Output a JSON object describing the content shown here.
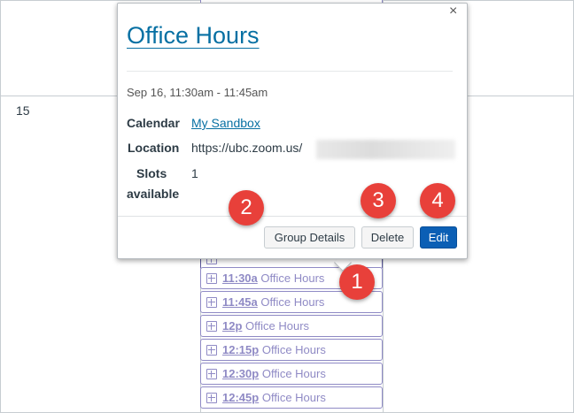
{
  "calendar": {
    "day_number": "15"
  },
  "events": [
    {
      "time": "11:30a",
      "title": "Office Hours"
    },
    {
      "time": "11:45a",
      "title": "Office Hours"
    },
    {
      "time": "12p",
      "title": "Office Hours"
    },
    {
      "time": "12:15p",
      "title": "Office Hours"
    },
    {
      "time": "12:30p",
      "title": "Office Hours"
    },
    {
      "time": "12:45p",
      "title": "Office Hours"
    }
  ],
  "popover": {
    "close": "×",
    "title": "Office Hours",
    "date": "Sep 16, 11:30am - 11:45am",
    "calendar_label": "Calendar",
    "calendar_value": "My Sandbox",
    "location_label": "Location",
    "location_value": "https://ubc.zoom.us/",
    "slots_label_1": "Slots",
    "slots_label_2": "available",
    "slots_value": "1",
    "buttons": {
      "group_details": "Group Details",
      "delete": "Delete",
      "edit": "Edit"
    }
  },
  "callouts": [
    "1",
    "2",
    "3",
    "4"
  ],
  "colors": {
    "accent": "#0770a3",
    "primary_button": "#0b5fb5",
    "event": "#8f8ac5",
    "callout": "#e8403a"
  }
}
